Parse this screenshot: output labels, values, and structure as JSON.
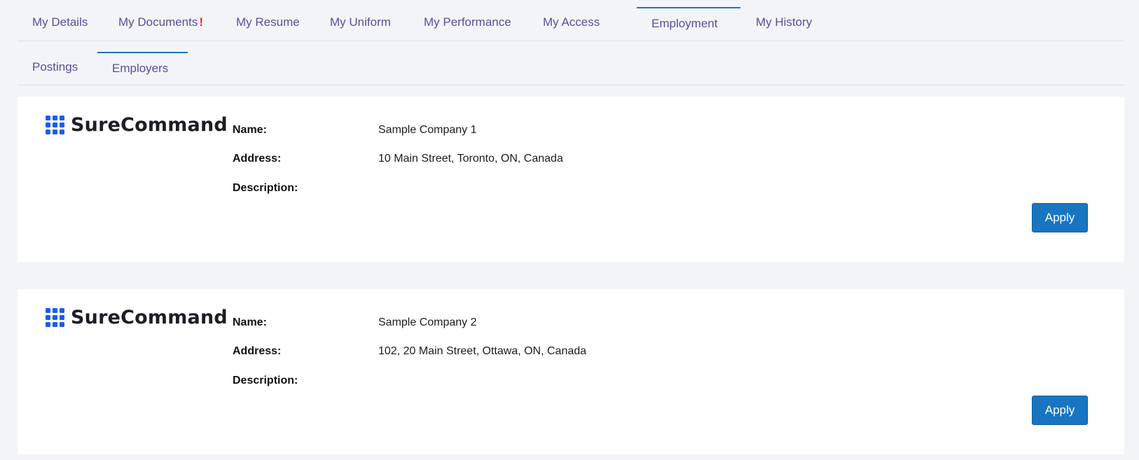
{
  "tabs": [
    {
      "label": "My Details"
    },
    {
      "label": "My Documents",
      "alert": "!"
    },
    {
      "label": "My Resume"
    },
    {
      "label": "My Uniform"
    },
    {
      "label": "My Performance"
    },
    {
      "label": "My Access"
    },
    {
      "label": "Employment"
    },
    {
      "label": "My History"
    }
  ],
  "active_tab": "Employment",
  "subtabs": [
    {
      "label": "Postings"
    },
    {
      "label": "Employers"
    }
  ],
  "active_subtab": "Employers",
  "labels": {
    "name": "Name:",
    "address": "Address:",
    "description": "Description:"
  },
  "employers": [
    {
      "logo_text": "SureCommand",
      "name": "Sample Company 1",
      "address": "10 Main Street, Toronto, ON, Canada",
      "description": "",
      "apply_label": "Apply"
    },
    {
      "logo_text": "SureCommand",
      "name": "Sample Company 2",
      "address": "102, 20 Main Street, Ottawa, ON, Canada",
      "description": "",
      "apply_label": "Apply"
    }
  ],
  "colors": {
    "accent": "#1875c2",
    "tab_text": "#55509e",
    "logo_blue": "#1a5cf0",
    "alert": "#e02a2a"
  },
  "icons": {
    "logo": "grid-dots-icon"
  }
}
